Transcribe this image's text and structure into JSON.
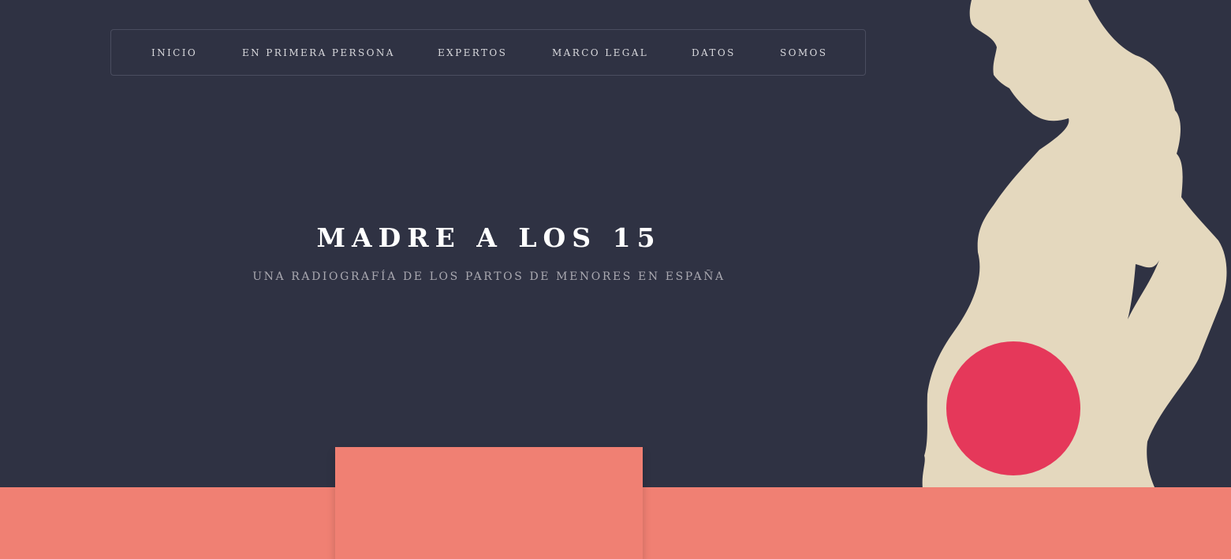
{
  "nav": {
    "items": [
      {
        "label": "INICIO"
      },
      {
        "label": "EN PRIMERA PERSONA"
      },
      {
        "label": "EXPERTOS"
      },
      {
        "label": "MARCO LEGAL"
      },
      {
        "label": "DATOS"
      },
      {
        "label": "SOMOS"
      }
    ]
  },
  "hero": {
    "title": "MADRE A LOS 15",
    "subtitle": "UNA RADIOGRAFÍA DE LOS PARTOS DE MENORES EN ESPAÑA"
  },
  "colors": {
    "background": "#2f3243",
    "silhouette": "#e4d8be",
    "accent_circle": "#e5385a",
    "band": "#f08073",
    "nav_text": "#d9d9dd",
    "subtitle_text": "#a9a8b0"
  },
  "illustration": {
    "icon": "pregnant-woman-silhouette-icon"
  }
}
